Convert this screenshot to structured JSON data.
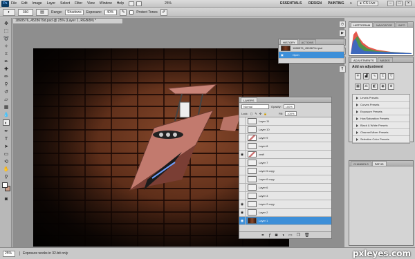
{
  "menubar": {
    "logo": "Ps",
    "items": [
      "File",
      "Edit",
      "Image",
      "Layer",
      "Select",
      "Filter",
      "View",
      "Window",
      "Help"
    ],
    "zoom": "25%",
    "workspaces": [
      "ESSENTIALS",
      "DESIGN",
      "PAINTING"
    ],
    "more": "»",
    "cs_live": "CS Live"
  },
  "options": {
    "brush_size": "360",
    "range_label": "Range:",
    "range_value": "Shadows",
    "exposure_label": "Exposure:",
    "exposure_value": "40%",
    "protect_tones": "Protect Tones"
  },
  "document": {
    "tab_title": "1868576_4528679d.psd @ 25% (Layer 1, RGB/8#) *"
  },
  "history_panel": {
    "tabs": [
      "HISTORY",
      "ACTIONS"
    ],
    "snapshot": "1868576_4528679d.psd",
    "step": "Open"
  },
  "histogram_panel": {
    "tabs": [
      "HISTOGRAM",
      "NAVIGATOR",
      "INFO"
    ]
  },
  "adjustments_panel": {
    "tabs": [
      "ADJUSTMENTS",
      "MASKS"
    ],
    "title": "Add an adjustment",
    "presets": [
      "Levels Presets",
      "Curves Presets",
      "Exposure Presets",
      "Hue/Saturation Presets",
      "Black & White Presets",
      "Channel Mixer Presets",
      "Selective Color Presets"
    ]
  },
  "bottom_tabs": [
    "CHANNELS",
    "PATHS"
  ],
  "layers_panel": {
    "title": "LAYERS",
    "blend_mode": "Normal",
    "opacity_label": "Opacity:",
    "opacity_value": "100%",
    "lock_label": "Lock:",
    "fill_label": "Fill:",
    "fill_value": "100%",
    "layers": [
      {
        "name": "Layer 11",
        "visible": false,
        "thumb": "plain"
      },
      {
        "name": "Layer 10",
        "visible": false,
        "thumb": "plain"
      },
      {
        "name": "Layer 9",
        "visible": false,
        "thumb": "shape"
      },
      {
        "name": "Layer 8",
        "visible": false,
        "thumb": "plain"
      },
      {
        "name": "craft",
        "visible": true,
        "thumb": "shape"
      },
      {
        "name": "Layer 7",
        "visible": false,
        "thumb": "plain"
      },
      {
        "name": "Layer 5 copy",
        "visible": false,
        "thumb": "plain"
      },
      {
        "name": "Layer 6 copy",
        "visible": false,
        "thumb": "plain"
      },
      {
        "name": "Layer 6",
        "visible": false,
        "thumb": "plain"
      },
      {
        "name": "Layer 3",
        "visible": false,
        "thumb": "plain"
      },
      {
        "name": "Layer 2 copy",
        "visible": true,
        "thumb": "plain"
      },
      {
        "name": "Layer 2",
        "visible": true,
        "thumb": "plain"
      },
      {
        "name": "Layer 1",
        "visible": true,
        "thumb": "dark",
        "selected": true
      }
    ]
  },
  "status": {
    "zoom": "25%",
    "message": "Exposure works in 32-bit only"
  },
  "watermark": "pxleyes.com",
  "colors": {
    "foreground": "#ffffff",
    "background": "#c79a86",
    "selection": "#3d8fd8"
  }
}
